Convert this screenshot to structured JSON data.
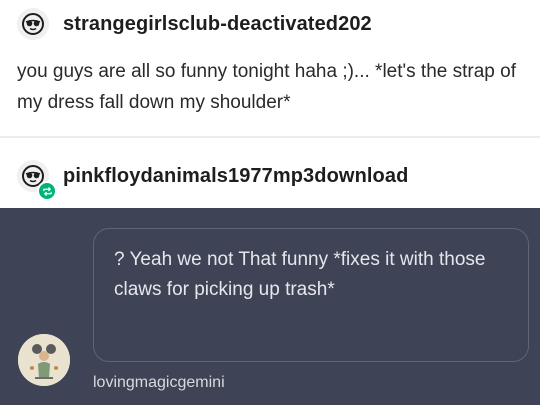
{
  "post": {
    "username": "strangegirlsclub-deactivated202",
    "avatar_icon": "sunglasses-face-icon",
    "body": "you guys are all so funny tonight haha ;)... *let's the strap of my dress fall down my shoulder*"
  },
  "reblog": {
    "username": "pinkfloydanimals1977mp3download",
    "avatar_icon": "sunglasses-face-icon",
    "badge_icon": "reblog-icon",
    "badge_color": "#00b37a"
  },
  "comment": {
    "text": "? Yeah we not That funny *fixes it with those claws for picking up trash*",
    "commenter": "lovingmagicgemini",
    "panel_color": "#3e4356"
  }
}
